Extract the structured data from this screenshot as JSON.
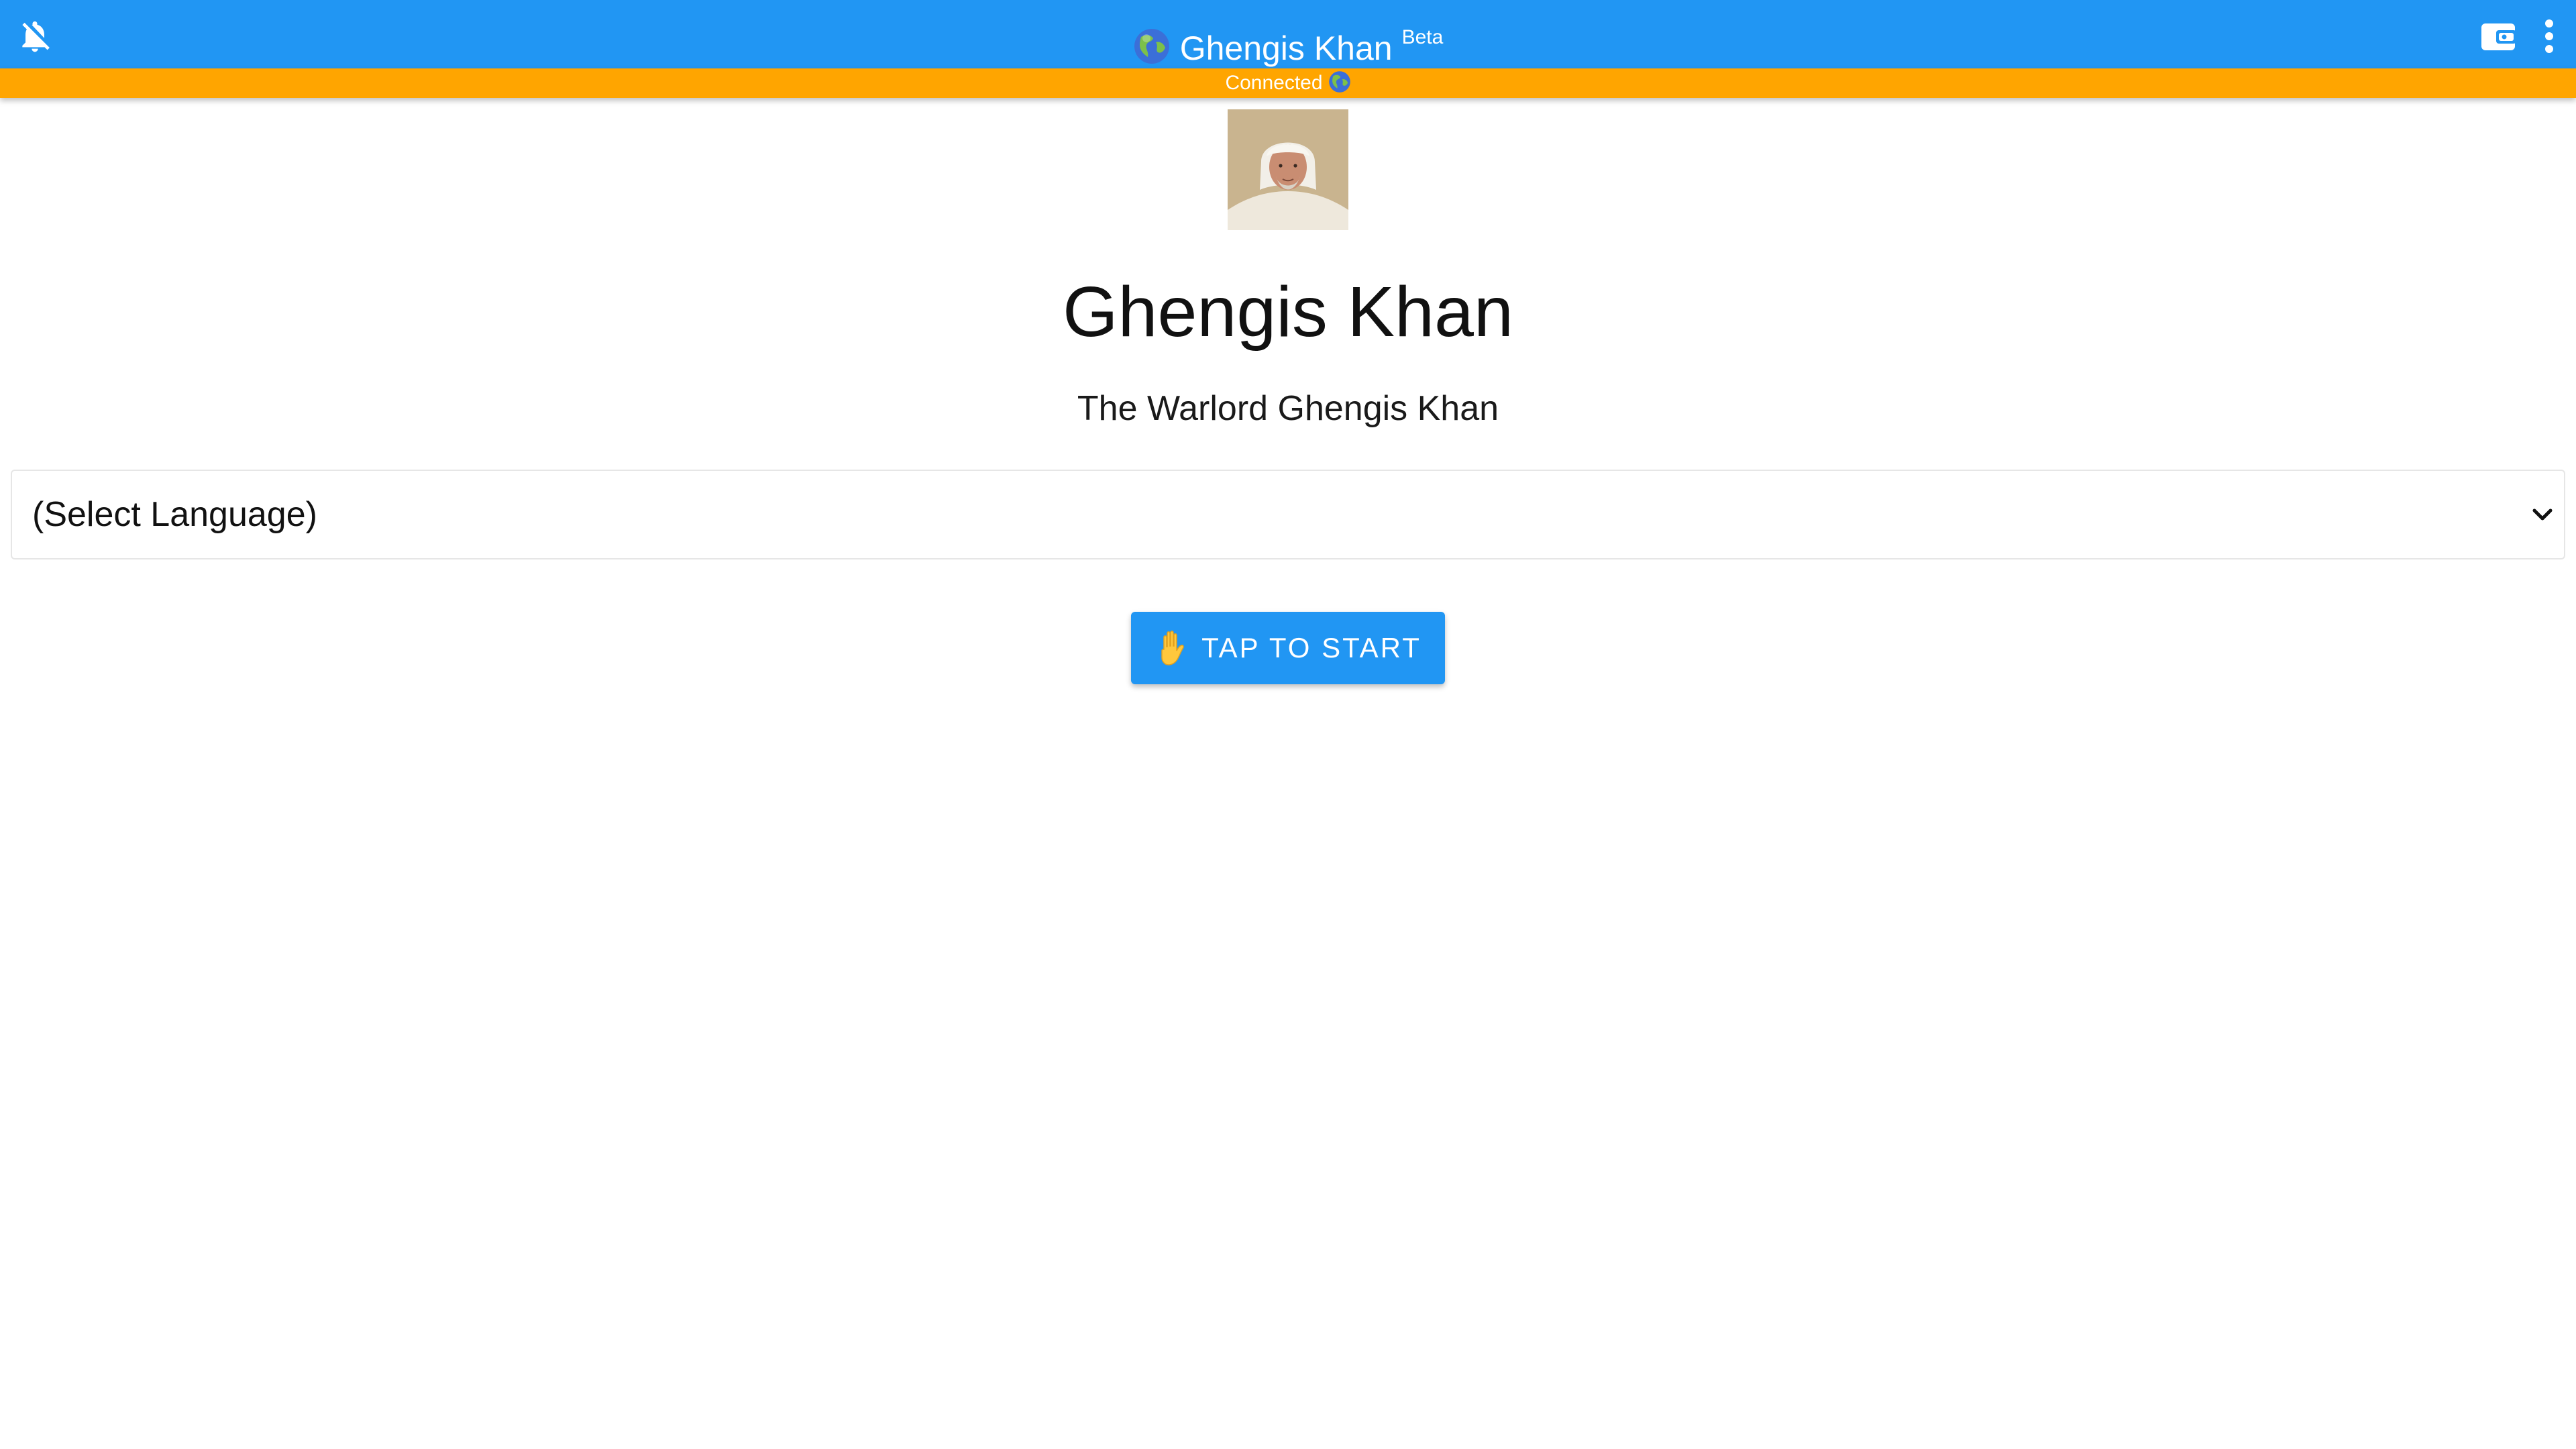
{
  "colors": {
    "appbar_bg": "#2196f3",
    "connection_bar_bg": "#ffa500",
    "button_bg": "#2196f3",
    "text_on_accent": "#ffffff"
  },
  "icons": {
    "left": "notifications-off-icon",
    "title": "globe-icon",
    "connection": "globe-icon",
    "wallet": "wallet-icon",
    "menu": "more-vertical-icon",
    "button": "raised-hand-icon",
    "select": "chevron-down-icon"
  },
  "header": {
    "title": "Ghengis Khan",
    "badge": "Beta"
  },
  "connection": {
    "status": "Connected"
  },
  "main": {
    "title": "Ghengis Khan",
    "subtitle": "The Warlord Ghengis Khan",
    "language_select": {
      "value": "(Select Language)"
    },
    "start_button": {
      "label": "TAP TO START"
    }
  }
}
